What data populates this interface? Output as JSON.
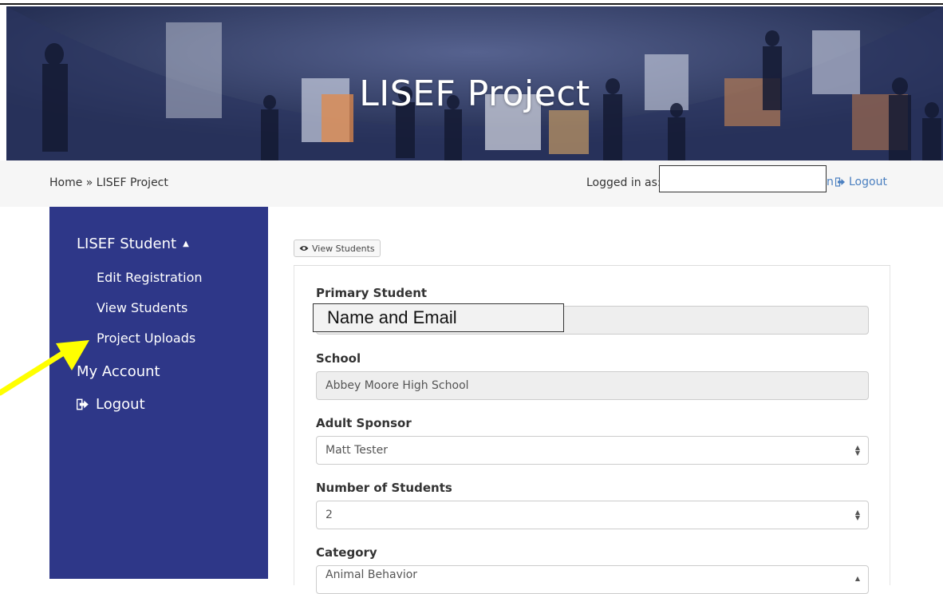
{
  "banner": {
    "title": "LISEF Project"
  },
  "breadcrumb": {
    "text": "Home » LISEF Project"
  },
  "header": {
    "logged_in_label": "Logged in as:",
    "logout_label": "Logout",
    "tail_char": "n"
  },
  "sidebar": {
    "section_label": "LISEF Student",
    "items": [
      {
        "label": "Edit Registration"
      },
      {
        "label": "View Students"
      },
      {
        "label": "Project Uploads"
      }
    ],
    "my_account_label": "My Account",
    "logout_label": "Logout"
  },
  "toolbar": {
    "view_students_label": "View Students"
  },
  "form": {
    "primary_student_label": "Primary Student",
    "primary_student_overlay": "Name and Email",
    "school_label": "School",
    "school_value": "Abbey Moore High School",
    "adult_sponsor_label": "Adult Sponsor",
    "adult_sponsor_value": "Matt Tester",
    "num_students_label": "Number of Students",
    "num_students_value": "2",
    "category_label": "Category",
    "category_value": "Animal Behavior"
  },
  "colors": {
    "sidebar_bg": "#2e3788",
    "link": "#4a7fc0",
    "arrow": "#ffff00"
  }
}
